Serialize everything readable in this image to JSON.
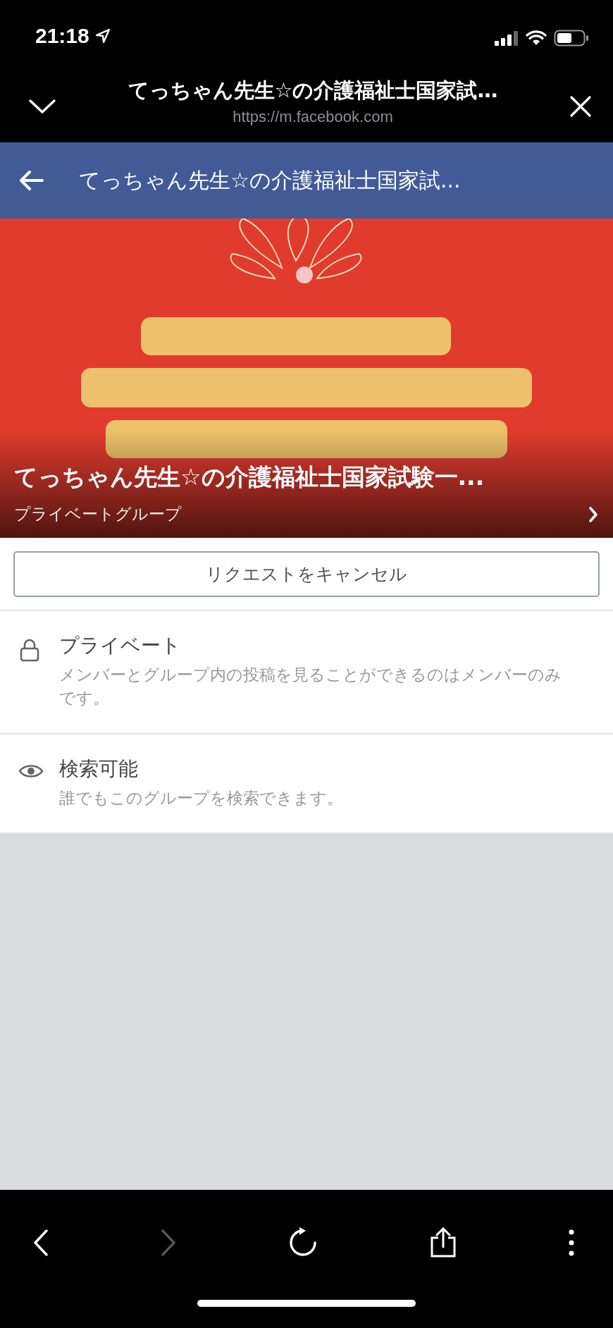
{
  "status_bar": {
    "time": "21:18"
  },
  "browser": {
    "title": "てっちゃん先生☆の介護福祉士国家試…",
    "url": "https://m.facebook.com"
  },
  "header": {
    "title": "てっちゃん先生☆の介護福祉士国家試..."
  },
  "group": {
    "name": "てっちゃん先生☆の介護福祉士国家試験一...",
    "type": "プライベートグループ"
  },
  "cancel_button": {
    "label": "リクエストをキャンセル"
  },
  "info_items": [
    {
      "kind": "lock",
      "title": "プライベート",
      "description": "メンバーとグループ内の投稿を見ることができるのはメンバーのみです。"
    },
    {
      "kind": "eye",
      "title": "検索可能",
      "description": "誰でもこのグループを検索できます。"
    }
  ],
  "toolbar": [
    {
      "kind": "back",
      "disabled": false
    },
    {
      "kind": "forward",
      "disabled": true
    },
    {
      "kind": "reload",
      "disabled": false
    },
    {
      "kind": "share",
      "disabled": false
    },
    {
      "kind": "more",
      "disabled": false
    }
  ]
}
